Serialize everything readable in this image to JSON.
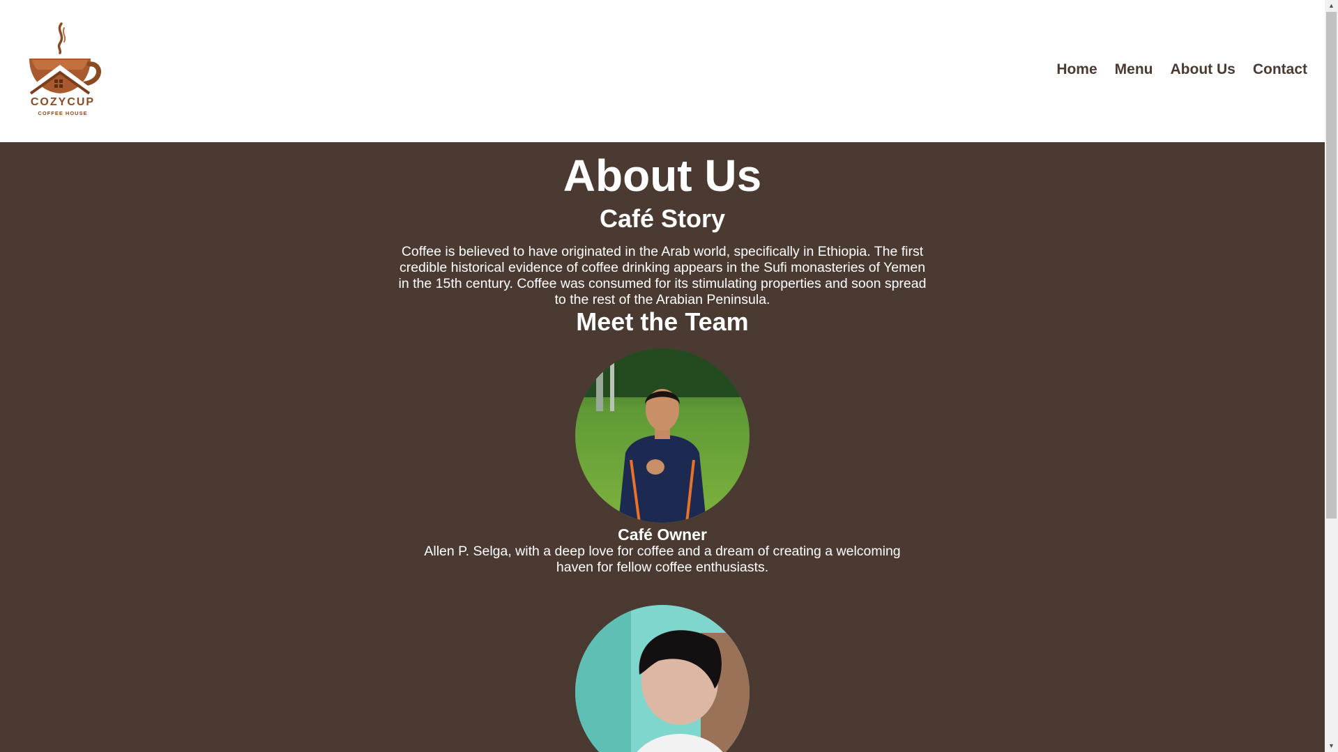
{
  "header": {
    "logo": {
      "name": "COZYCUP",
      "subtitle": "COFFEE HOUSE",
      "icon": "coffee-cup-house-icon"
    },
    "nav": [
      {
        "label": "Home"
      },
      {
        "label": "Menu"
      },
      {
        "label": "About Us"
      },
      {
        "label": "Contact"
      }
    ]
  },
  "main": {
    "title": "About Us",
    "story_heading": "Café Story",
    "story_text": "Coffee is believed to have originated in the Arab world, specifically in Ethiopia. The first credible historical evidence of coffee drinking appears in the Sufi monasteries of Yemen in the 15th century. Coffee was consumed for its stimulating properties and soon spread to the rest of the Arabian Peninsula.",
    "team_heading": "Meet the Team",
    "team": [
      {
        "role": "Café Owner",
        "description": "Allen P. Selga, with a deep love for coffee and a dream of creating a welcoming haven for fellow coffee enthusiasts."
      },
      {
        "role": "",
        "description": ""
      }
    ]
  },
  "colors": {
    "main_background": "#4b3a32",
    "nav_text": "#4a3a30",
    "logo_brown": "#8a4a22",
    "text": "#ffffff"
  }
}
